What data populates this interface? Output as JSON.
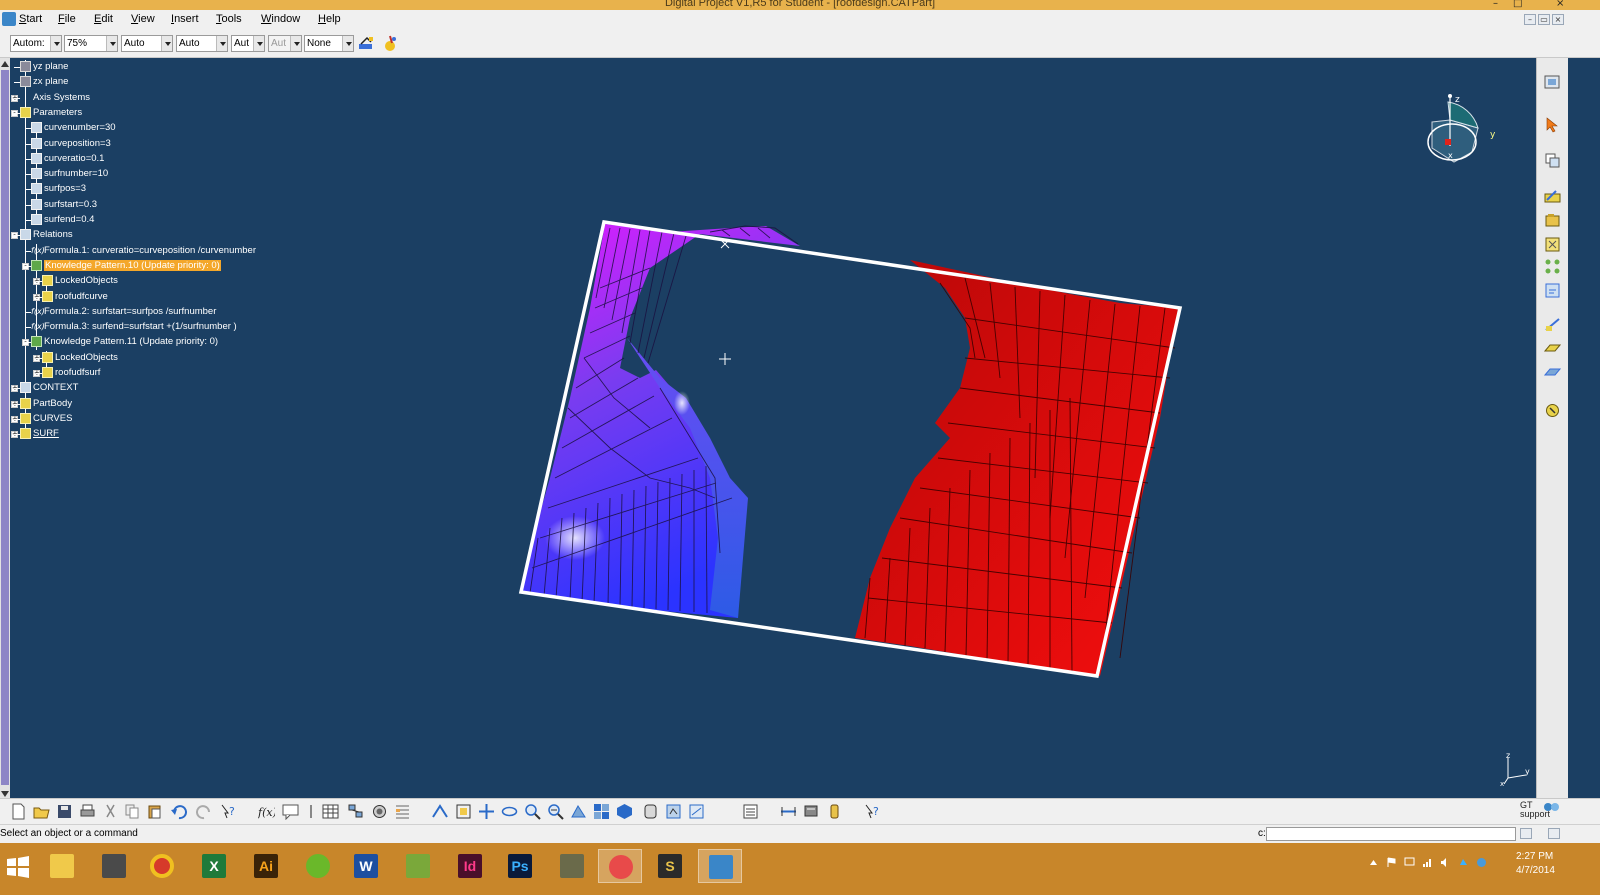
{
  "window": {
    "title": "Digital Project V1,R5 for Student - [roofdesign.CATPart]",
    "controls": {
      "minimize": "–",
      "maximize": "□",
      "close": "×"
    }
  },
  "menu": {
    "items": [
      "Start",
      "File",
      "Edit",
      "View",
      "Insert",
      "Tools",
      "Window",
      "Help"
    ],
    "mdi_controls": [
      "–",
      "▭",
      "×"
    ]
  },
  "toolbar": {
    "combos": [
      {
        "value": "Autom:",
        "enabled": true
      },
      {
        "value": "75%",
        "enabled": true
      },
      {
        "value": "Auto",
        "enabled": true
      },
      {
        "value": "Auto",
        "enabled": true
      },
      {
        "value": "Aut",
        "enabled": true
      },
      {
        "value": "Aut",
        "enabled": false
      },
      {
        "value": "None",
        "enabled": true
      }
    ],
    "icons": [
      "painter-icon",
      "format-brush-icon"
    ]
  },
  "tree": {
    "nodes": [
      {
        "label": "yz plane",
        "icon": "plane-icon",
        "level": 0
      },
      {
        "label": "zx plane",
        "icon": "plane-icon",
        "level": 0
      },
      {
        "label": "Axis Systems",
        "icon": "axis-system-icon",
        "level": 0,
        "expander": "+"
      },
      {
        "label": "Parameters",
        "icon": "parameters-icon",
        "level": 0,
        "expander": "-"
      },
      {
        "label": "curvenumber=30",
        "icon": "parameter-icon",
        "level": 1
      },
      {
        "label": "curveposition=3",
        "icon": "parameter-icon",
        "level": 1
      },
      {
        "label": "curveratio=0.1",
        "icon": "parameter-icon",
        "level": 1
      },
      {
        "label": "surfnumber=10",
        "icon": "parameter-icon",
        "level": 1
      },
      {
        "label": "surfpos=3",
        "icon": "parameter-icon",
        "level": 1
      },
      {
        "label": "surfstart=0.3",
        "icon": "parameter-icon",
        "level": 1
      },
      {
        "label": "surfend=0.4",
        "icon": "parameter-icon",
        "level": 1
      },
      {
        "label": "Relations",
        "icon": "relations-icon",
        "level": 0,
        "expander": "-"
      },
      {
        "label": "Formula.1: curveratio=curveposition /curvenumber",
        "icon": "formula-icon",
        "level": 1
      },
      {
        "label": "Knowledge Pattern.10 (Update priority: 0)",
        "icon": "knowledge-pattern-icon",
        "level": 1,
        "expander": "-",
        "selected": true
      },
      {
        "label": "LockedObjects",
        "icon": "list-icon",
        "level": 2,
        "expander": "+"
      },
      {
        "label": "roofudfcurve",
        "icon": "list-icon",
        "level": 2,
        "expander": "+"
      },
      {
        "label": "Formula.2: surfstart=surfpos /surfnumber",
        "icon": "formula-icon",
        "level": 1
      },
      {
        "label": "Formula.3: surfend=surfstart +(1/surfnumber )",
        "icon": "formula-icon",
        "level": 1
      },
      {
        "label": "Knowledge Pattern.11 (Update priority: 0)",
        "icon": "knowledge-pattern-icon",
        "level": 1,
        "expander": "-"
      },
      {
        "label": "LockedObjects",
        "icon": "list-icon",
        "level": 2,
        "expander": "+"
      },
      {
        "label": "roofudfsurf",
        "icon": "list-icon",
        "level": 2,
        "expander": "+"
      },
      {
        "label": "CONTEXT",
        "icon": "context-icon",
        "level": 0,
        "expander": "+"
      },
      {
        "label": "PartBody",
        "icon": "partbody-icon",
        "level": 0,
        "expander": "+"
      },
      {
        "label": "CURVES",
        "icon": "geometrical-set-icon",
        "level": 0,
        "expander": "+"
      },
      {
        "label": "SURF",
        "icon": "geometrical-set-icon",
        "level": 0,
        "expander": "+",
        "underline": true
      }
    ]
  },
  "compass": {
    "labels": [
      "z",
      "y",
      "x"
    ]
  },
  "axis_indicator": {
    "labels": [
      "z",
      "y",
      "x"
    ]
  },
  "viewport": {
    "background": "#1b3f63",
    "frame_color": "#ffffff",
    "left_surface_colors": [
      "#e21bff",
      "#7a3cf0",
      "#2b33ff"
    ],
    "right_surface_color": "#d80a0a"
  },
  "bottom_toolbar": {
    "gt_support": [
      "GT",
      "support"
    ]
  },
  "status": {
    "message": "Select an object or a command",
    "command_label": "c:",
    "command_value": ""
  },
  "taskbar": {
    "apps": [
      {
        "name": "windows-start-icon",
        "text": ""
      },
      {
        "name": "file-explorer-icon",
        "text": ""
      },
      {
        "name": "drafting-app-icon",
        "text": ""
      },
      {
        "name": "chrome-icon",
        "text": ""
      },
      {
        "name": "excel-icon",
        "text": "X"
      },
      {
        "name": "illustrator-icon",
        "text": "Ai"
      },
      {
        "name": "spotify-icon",
        "text": ""
      },
      {
        "name": "word-icon",
        "text": "W"
      },
      {
        "name": "project-app-icon",
        "text": ""
      },
      {
        "name": "indesign-icon",
        "text": "Id"
      },
      {
        "name": "photoshop-icon",
        "text": "Ps"
      },
      {
        "name": "app-icon",
        "text": ""
      },
      {
        "name": "snipping-tool-icon",
        "text": ""
      },
      {
        "name": "sketchup-icon",
        "text": "S"
      },
      {
        "name": "digital-project-icon",
        "text": ""
      }
    ],
    "clock_time": "2:27 PM",
    "clock_date": "4/7/2014"
  }
}
